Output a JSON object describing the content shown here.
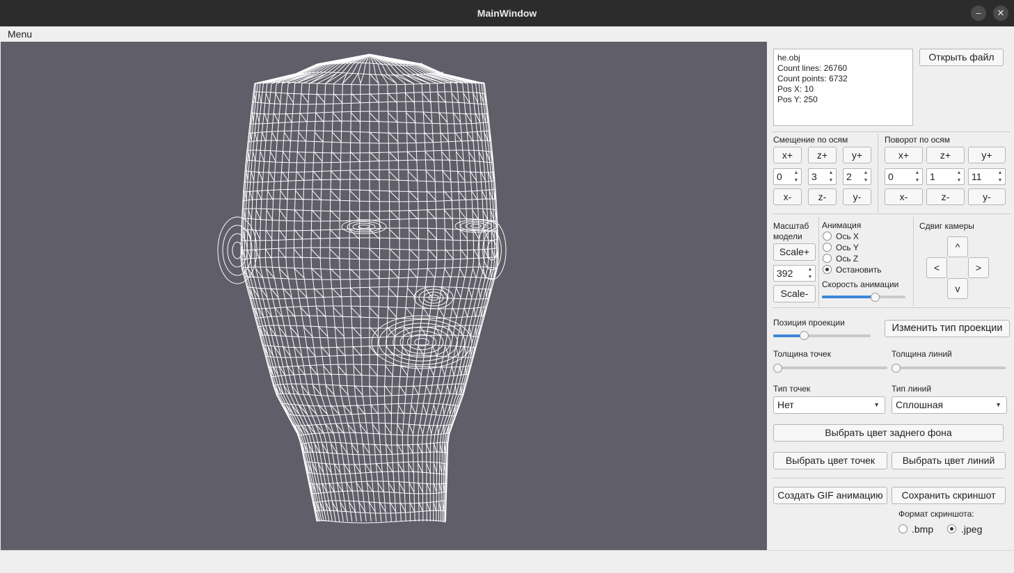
{
  "window": {
    "title": "MainWindow",
    "minimize_icon": "minimize-icon",
    "close_icon": "close-icon",
    "minimize_glyph": "–",
    "close_glyph": "✕"
  },
  "menubar": {
    "menu": "Menu"
  },
  "info": {
    "lines": [
      "he.obj",
      "Count lines: 26760",
      "Count points: 6732",
      "Pos X: 10",
      "Pos Y: 250"
    ]
  },
  "open_file": "Открыть файл",
  "translate": {
    "label": "Смещение по осям",
    "plus": [
      "x+",
      "z+",
      "y+"
    ],
    "values": [
      "0",
      "3",
      "2"
    ],
    "minus": [
      "x-",
      "z-",
      "y-"
    ]
  },
  "rotate": {
    "label": "Поворот по осям",
    "plus": [
      "x+",
      "z+",
      "y+"
    ],
    "values": [
      "0",
      "1",
      "11"
    ],
    "minus": [
      "x-",
      "z-",
      "y-"
    ]
  },
  "scale": {
    "label_line1": "Масштаб",
    "label_line2": "модели",
    "plus": "Scale+",
    "value": "392",
    "minus": "Scale-"
  },
  "animation": {
    "label": "Анимация",
    "options": [
      "Ось X",
      "Ось Y",
      "Ось Z",
      "Остановить"
    ],
    "selected_index": 3,
    "speed_label": "Скорость анимации",
    "speed_fraction": 0.65
  },
  "camera": {
    "label": "Сдвиг камеры",
    "up": "^",
    "left": "<",
    "right": ">",
    "down": "v"
  },
  "projection": {
    "label": "Позиция проекции",
    "fraction": 0.3,
    "change_button": "Изменить тип проекции"
  },
  "point_size": {
    "label": "Толщина точек",
    "fraction": 0.0
  },
  "line_size": {
    "label": "Толщина линий",
    "fraction": 0.0
  },
  "point_type": {
    "label": "Тип точек",
    "value": "Нет"
  },
  "line_type": {
    "label": "Тип линий",
    "value": "Сплошная"
  },
  "buttons": {
    "bg_color": "Выбрать цвет заднего фона",
    "point_color": "Выбрать цвет точек",
    "line_color": "Выбрать цвет линий",
    "gif": "Создать GIF анимацию",
    "screenshot": "Сохранить скриншот"
  },
  "screenshot_format": {
    "label": "Формат скриншота:",
    "options": [
      ".bmp",
      ".jpeg"
    ],
    "selected_index": 1
  },
  "colors": {
    "viewport_bg": "#5f5e69",
    "wire": "#ffffff",
    "accent": "#3c86d8"
  }
}
